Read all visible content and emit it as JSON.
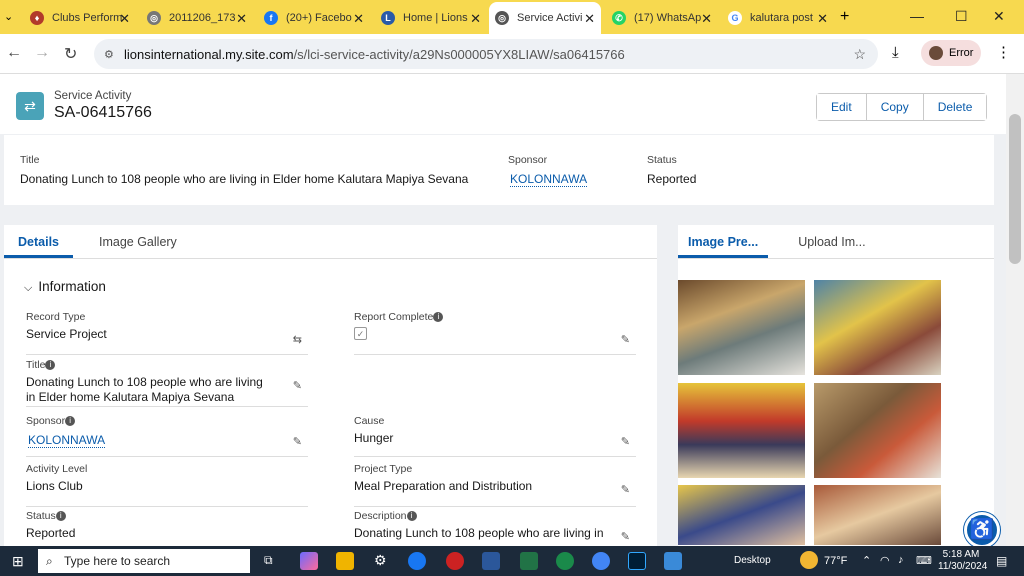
{
  "browser": {
    "tabs": [
      {
        "label": "Clubs Perform",
        "color": "#b23b2a"
      },
      {
        "label": "2011206_173",
        "color": "#666666"
      },
      {
        "label": "(20+) Facebo",
        "color": "#1877f2"
      },
      {
        "label": "Home | Lions",
        "color": "#2a5aa8"
      },
      {
        "label": "Service Activi",
        "color": "#555555"
      },
      {
        "label": "(17) WhatsAp",
        "color": "#25d366"
      },
      {
        "label": "kalutara post",
        "color": "#4285f4"
      }
    ],
    "url_domain": "lionsinternational.my.site.com",
    "url_path": "/s/lci-service-activity/a29Ns000005YX8LIAW/sa06415766",
    "profile_label": "Error"
  },
  "record": {
    "object_label": "Service Activity",
    "name": "SA-06415766",
    "actions": [
      "Edit",
      "Copy",
      "Delete"
    ]
  },
  "highlights": {
    "title_label": "Title",
    "title_value": "Donating Lunch to 108 people who are living in Elder home Kalutara Mapiya Sevana",
    "sponsor_label": "Sponsor",
    "sponsor_value": "KOLONNAWA",
    "status_label": "Status",
    "status_value": "Reported"
  },
  "detail_tabs": [
    "Details",
    "Image Gallery"
  ],
  "section_title": "Information",
  "fields": {
    "record_type_label": "Record Type",
    "record_type_value": "Service Project",
    "report_complete_label": "Report Complete",
    "title_label": "Title",
    "title_value": "Donating Lunch to 108 people who are living in Elder home Kalutara Mapiya Sevana",
    "sponsor_label": "Sponsor",
    "sponsor_value": "KOLONNAWA",
    "cause_label": "Cause",
    "cause_value": "Hunger",
    "activity_level_label": "Activity Level",
    "activity_level_value": "Lions Club",
    "project_type_label": "Project Type",
    "project_type_value": "Meal Preparation and Distribution",
    "status_label": "Status",
    "status_value": "Reported",
    "description_label": "Description",
    "description_value": "Donating Lunch to 108 people who are living in"
  },
  "image_tabs": [
    "Image Pre...",
    "Upload Im..."
  ],
  "taskbar": {
    "search_placeholder": "Type here to search",
    "desktop_label": "Desktop",
    "weather": "77°F",
    "time": "5:18 AM",
    "date": "11/30/2024"
  }
}
